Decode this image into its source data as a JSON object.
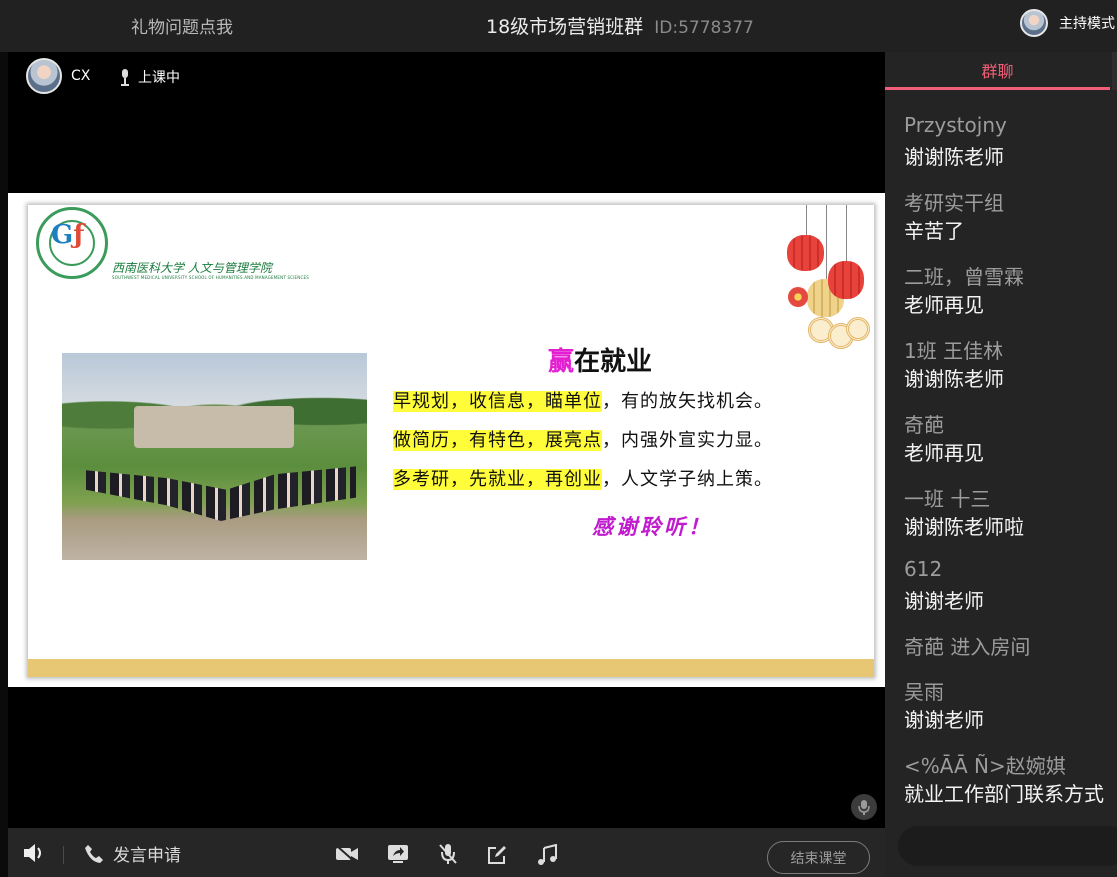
{
  "topbar": {
    "gift_link": "礼物问题点我",
    "class_title": "18级市场营销班群",
    "room_id": "ID:5778377",
    "host_mode": "主持模式"
  },
  "stage": {
    "teacher_name": "CX",
    "class_status": "上课中"
  },
  "slide": {
    "university_name": "西南医科大学 人文与管理学院",
    "university_en": "SOUTHWEST MEDICAL UNIVERSITY SCHOOL OF HUMANITIES AND MANAGEMENT SCIENCES",
    "title_win": "赢",
    "title_rest": "在就业",
    "lines": [
      {
        "highlight": "早规划，收信息，瞄单位",
        "rest": "，有的放矢找机会。"
      },
      {
        "highlight": "做简历，有特色，展亮点",
        "rest": "，内强外宣实力显。"
      },
      {
        "highlight": "多考研，先就业，再创业",
        "rest": "，人文学子纳上策。"
      }
    ],
    "thanks": "感谢聆听！"
  },
  "controls": {
    "speak_request": "发言申请",
    "end_class": "结束课堂"
  },
  "chat": {
    "tab_label": "群聊",
    "messages": [
      {
        "user": "Przystojny",
        "text": "谢谢陈老师"
      },
      {
        "user": "考研实干组",
        "text": "辛苦了"
      },
      {
        "user": "二班，曾雪霖",
        "text": "老师再见"
      },
      {
        "user": "1班  王佳林",
        "text": "谢谢陈老师"
      },
      {
        "user": "奇葩",
        "text": "老师再见"
      },
      {
        "user": "一班 十三",
        "text": "谢谢陈老师啦"
      },
      {
        "user": "612",
        "text": "谢谢老师"
      }
    ],
    "system_notice": "奇葩 进入房间",
    "messages_after": [
      {
        "user": "吴雨",
        "text": "谢谢老师"
      },
      {
        "user": "<%ĀĀ Ñ>赵婉娸",
        "text": "就业工作部门联系方式"
      }
    ]
  },
  "colors": {
    "accent": "#f05f77",
    "highlight": "#fffd3a",
    "win_magenta": "#e41fd2",
    "thanks_purple": "#c11bd0",
    "slide_band": "#e7c773"
  }
}
